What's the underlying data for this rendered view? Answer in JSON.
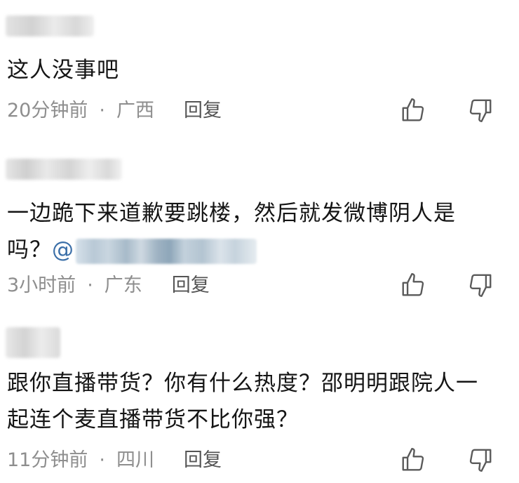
{
  "comments": [
    {
      "text": "这人没事吧",
      "time": "20分钟前",
      "dot": "·",
      "location": "广西",
      "reply": "回复"
    },
    {
      "text": "一边跪下来道歉要跳楼，然后就发微博阴人是吗？",
      "mention_prefix": "@",
      "time": "3小时前",
      "dot": "·",
      "location": "广东",
      "reply": "回复"
    },
    {
      "text": "跟你直播带货？你有什么热度？邵明明跟院人一起连个麦直播带货不比你强？",
      "time": "11分钟前",
      "dot": "·",
      "location": "四川",
      "reply": "回复"
    }
  ],
  "icons": {
    "like": "thumbs-up-icon",
    "dislike": "thumbs-down-icon"
  },
  "colors": {
    "text": "#151515",
    "meta": "#8e8e8e",
    "reply": "#555555",
    "icon": "#5a5a5a",
    "mention": "#3b6fa8"
  }
}
